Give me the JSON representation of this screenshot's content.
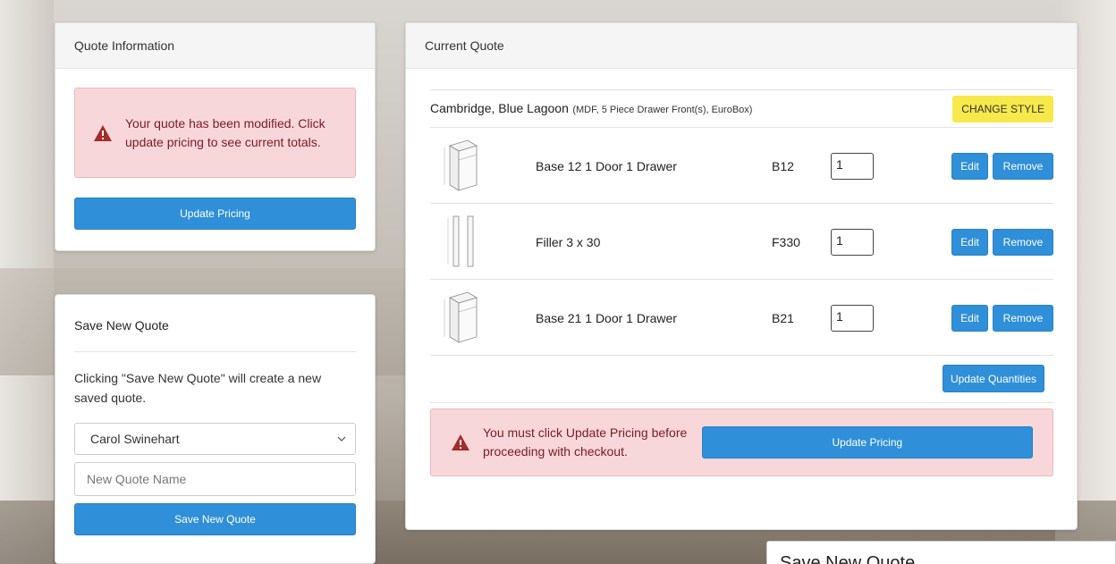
{
  "quote_info": {
    "header": "Quote Information",
    "alert_text": "Your quote has been modified. Click update pricing to see current totals.",
    "update_button": "Update Pricing"
  },
  "save_quote": {
    "title": "Save New Quote",
    "description": "Clicking \"Save New Quote\" will create a new saved quote.",
    "selected_user": "Carol Swinehart",
    "name_placeholder": "New Quote Name",
    "save_button": "Save New Quote"
  },
  "current_quote": {
    "header": "Current Quote",
    "style_name": "Cambridge, Blue Lagoon",
    "style_detail": "(MDF, 5 Piece Drawer Front(s), EuroBox)",
    "change_style_button": "CHANGE STYLE",
    "items": [
      {
        "name": "Base 12 1 Door 1 Drawer",
        "code": "B12",
        "qty": "1",
        "thumb": "base-cabinet"
      },
      {
        "name": "Filler 3 x 30",
        "code": "F330",
        "qty": "1",
        "thumb": "filler"
      },
      {
        "name": "Base 21 1 Door 1 Drawer",
        "code": "B21",
        "qty": "1",
        "thumb": "base-cabinet"
      }
    ],
    "edit_label": "Edit",
    "remove_label": "Remove",
    "update_quantities_button": "Update Quantities",
    "alert_text": "You must click Update Pricing before proceeding with checkout.",
    "update_pricing_button": "Update Pricing"
  },
  "dialog_peek": {
    "title": "Save New Quote"
  },
  "colors": {
    "primary": "#2f8fd8",
    "alert_bg": "#f8d7da",
    "alert_text": "#7a1b22",
    "warning_icon": "#a32c2c",
    "change_style_bg": "#f7e84b"
  }
}
